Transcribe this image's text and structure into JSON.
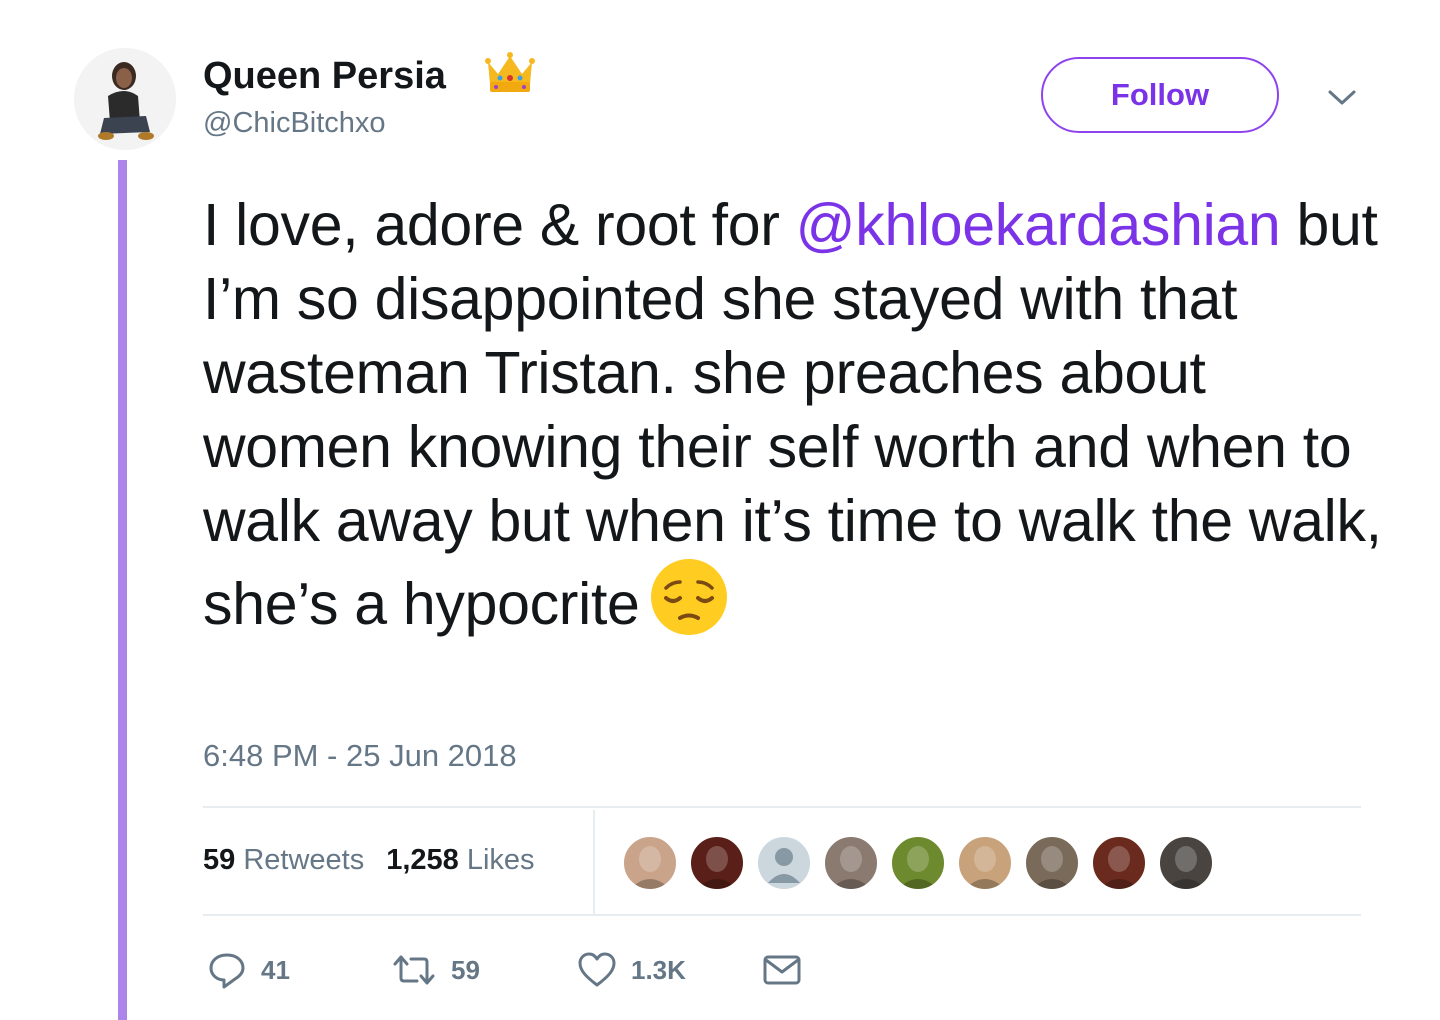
{
  "user": {
    "display_name": "Queen Persia",
    "handle": "@ChicBitchxo",
    "badge_icon": "crown-icon"
  },
  "follow_button": {
    "label": "Follow"
  },
  "menu": {
    "icon": "chevron-down-icon"
  },
  "tweet": {
    "text_before_mention": "I love, adore & root for ",
    "mention": "@khloekardashian",
    "text_after_mention": " but I’m so disappointed she stayed with that wasteman Tristan. she preaches about women knowing their self worth and when to walk away but when it’s time to walk the walk, she’s a hypocrite",
    "emoji": "pensive-face-emoji",
    "timestamp": "6:48 PM - 25 Jun 2018"
  },
  "stats": {
    "retweets_count": "59",
    "retweets_label": "Retweets",
    "likes_count": "1,258",
    "likes_label": "Likes"
  },
  "likers": [
    {
      "name": "liker-avatar-1",
      "color": "#c9a48a"
    },
    {
      "name": "liker-avatar-2",
      "color": "#5a1f18"
    },
    {
      "name": "liker-avatar-3",
      "color": "#ccd6dd",
      "default": true
    },
    {
      "name": "liker-avatar-4",
      "color": "#8a7a70"
    },
    {
      "name": "liker-avatar-5",
      "color": "#6e8a2e"
    },
    {
      "name": "liker-avatar-6",
      "color": "#c7a27a"
    },
    {
      "name": "liker-avatar-7",
      "color": "#7a6a5a"
    },
    {
      "name": "liker-avatar-8",
      "color": "#6b2a1e"
    },
    {
      "name": "liker-avatar-9",
      "color": "#4a4440"
    }
  ],
  "actions": {
    "reply_count": "41",
    "retweet_count": "59",
    "like_count": "1.3K"
  },
  "colors": {
    "accent": "#7b33e8",
    "thread_line": "#ad84ea",
    "secondary_text": "#657786",
    "divider": "#e6ecf0"
  }
}
